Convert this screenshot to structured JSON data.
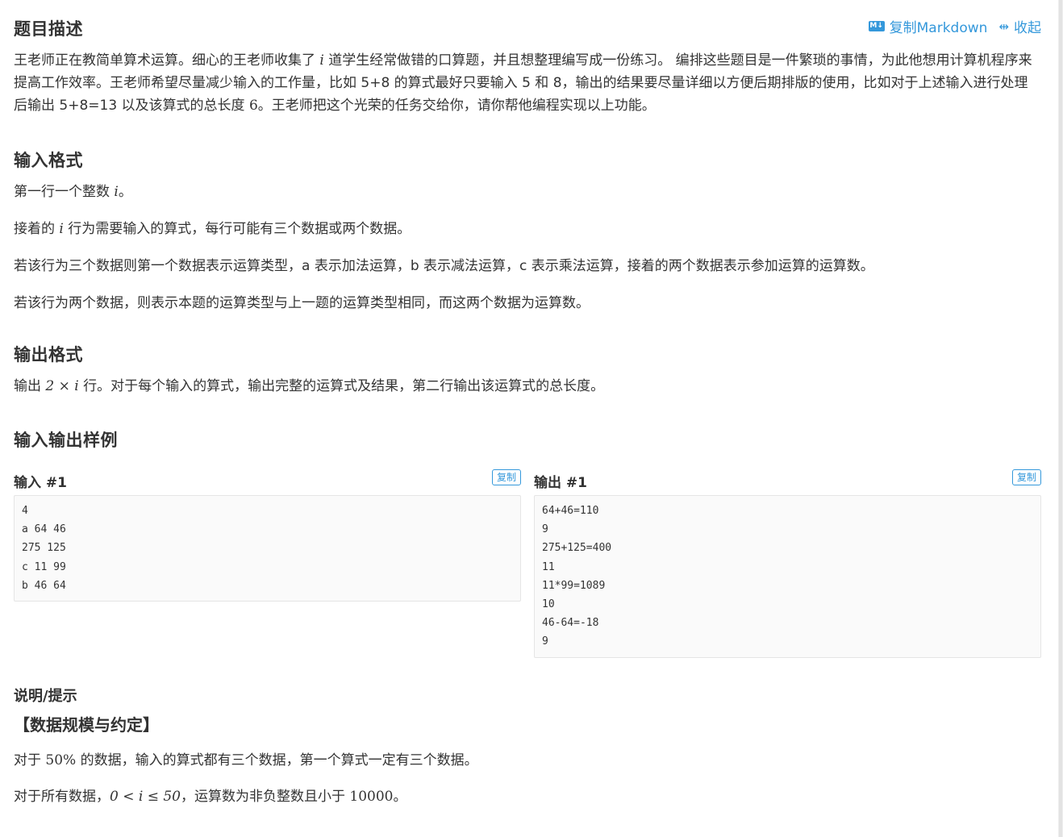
{
  "description": {
    "title": "题目描述",
    "copy_markdown": "复制Markdown",
    "collapse": "收起",
    "md_icon_text": "M↓",
    "collapse_icon": "⇹",
    "para_a": "王老师正在教简单算术运算。细心的王老师收集了",
    "para_b": "道学生经常做错的口算题，并且想整理编写成一份练习。 编排这些题目是一件繁琐的事情，为此他想用计算机程序来提高工作效率。王老师希望尽量减少输入的工作量，比如 5+8 的算式最好只要输入 5 和 8，输出的结果要尽量详细以方便后期排版的使用，比如对于上述输入进行处理后输出 5+8=13 以及该算式的总长度",
    "para_c": "。王老师把这个光荣的任务交给你，请你帮他编程实现以上功能。",
    "math_i": "i",
    "math_6": "6"
  },
  "input_format": {
    "title": "输入格式",
    "p1_a": "第一行一个整数",
    "p1_b": "。",
    "p2_a": "接着的",
    "p2_b": "行为需要输入的算式，每行可能有三个数据或两个数据。",
    "p3": "若该行为三个数据则第一个数据表示运算类型，a 表示加法运算，b 表示减法运算，c 表示乘法运算，接着的两个数据表示参加运算的运算数。",
    "p4": "若该行为两个数据，则表示本题的运算类型与上一题的运算类型相同，而这两个数据为运算数。"
  },
  "output_format": {
    "title": "输出格式",
    "p1_a": "输出",
    "math": "2 × i",
    "p1_b": "行。对于每个输入的算式，输出完整的运算式及结果，第二行输出该运算式的总长度。"
  },
  "samples": {
    "title": "输入输出样例",
    "input_label": "输入 #1",
    "output_label": "输出 #1",
    "copy_label": "复制",
    "input_lines": [
      "4",
      "a 64 46",
      "275 125",
      "c 11 99",
      "b 46 64"
    ],
    "output_lines": [
      "64+46=110",
      "9",
      "275+125=400",
      "11",
      "11*99=1089",
      "10",
      "46-64=-18",
      "9"
    ]
  },
  "hint": {
    "title": "说明/提示",
    "subtitle": "【数据规模与约定】",
    "p1_a": "对于",
    "p1_math": "50%",
    "p1_b": "的数据，输入的算式都有三个数据，第一个算式一定有三个数据。",
    "p2_a": "对于所有数据，",
    "p2_math": "0 < i ≤ 50",
    "p2_b": "，运算数为非负整数且小于",
    "p2_math2": "10000",
    "p2_c": "。"
  }
}
